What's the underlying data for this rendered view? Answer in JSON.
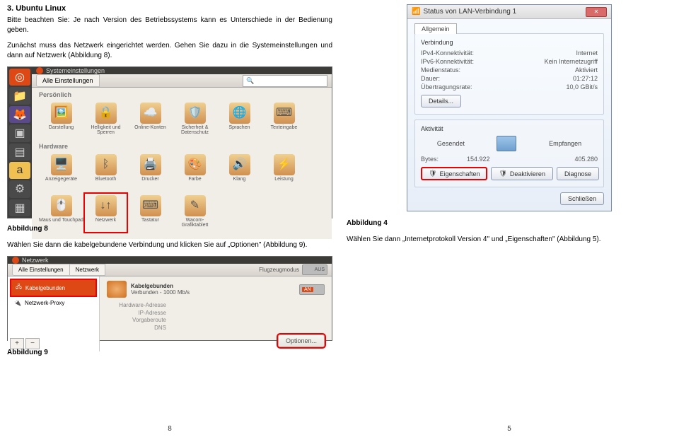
{
  "left": {
    "heading": "3. Ubuntu Linux",
    "p1": "Bitte beachten Sie: Je nach Version des Betriebssystems kann es Unterschiede in der Bedienung geben.",
    "p2": "Zunächst muss das Netzwerk eingerichtet werden. Gehen Sie dazu in die Systemeinstellungen und dann auf Netzwerk (Abbildung 8).",
    "ubuntu": {
      "window_title": "Systemeinstellungen",
      "crumb": "Alle Einstellungen",
      "search_placeholder": "",
      "search_icon": "🔍",
      "sect_personal": "Persönlich",
      "personal": [
        {
          "icon": "🖼️",
          "label": "Darstellung"
        },
        {
          "icon": "🔒",
          "label": "Helligkeit und Sperren"
        },
        {
          "icon": "☁️",
          "label": "Online-Konten"
        },
        {
          "icon": "🛡️",
          "label": "Sicherheit & Datenschutz"
        },
        {
          "icon": "🌐",
          "label": "Sprachen"
        },
        {
          "icon": "⌨",
          "label": "Texteingabe"
        }
      ],
      "sect_hardware": "Hardware",
      "hardware": [
        {
          "icon": "🖥️",
          "label": "Anzeigegeräte"
        },
        {
          "icon": "ᛒ",
          "label": "Bluetooth"
        },
        {
          "icon": "🖨️",
          "label": "Drucker"
        },
        {
          "icon": "🎨",
          "label": "Farbe"
        },
        {
          "icon": "🔊",
          "label": "Klang"
        },
        {
          "icon": "⚡",
          "label": "Leistung"
        },
        {
          "icon": "🖱️",
          "label": "Maus und Touchpad"
        },
        {
          "icon": "↓↑",
          "label": "Netzwerk",
          "hl": true
        },
        {
          "icon": "⌨",
          "label": "Tastatur"
        },
        {
          "icon": "✎",
          "label": "Wacom-Grafiktablett"
        }
      ]
    },
    "ab8": "Abbildung 8",
    "p3": "Wählen Sie dann die kabelgebundene Verbindung und klicken Sie auf „Optionen\" (Abbildung 9).",
    "unet": {
      "title": "Netzwerk",
      "crumb1": "Alle Einstellungen",
      "crumb2": "Netzwerk",
      "flugz": "Flugzeugmodus",
      "flugz_state": "AUS",
      "side": [
        {
          "icon": "🖧",
          "label": "Kabelgebunden",
          "sel": true
        },
        {
          "icon": "🔌",
          "label": "Netzwerk-Proxy"
        }
      ],
      "plus": "+",
      "minus": "−",
      "head": "Kabelgebunden",
      "sub": "Verbunden - 1000 Mb/s",
      "on_label": "AN",
      "rows": [
        {
          "k": "Hardware-Adresse",
          "v": ""
        },
        {
          "k": "IP-Adresse",
          "v": ""
        },
        {
          "k": "Vorgaberoute",
          "v": ""
        },
        {
          "k": "DNS",
          "v": ""
        }
      ],
      "opt": "Optionen..."
    },
    "ab9": "Abbildung 9",
    "page_no": "8"
  },
  "right": {
    "win": {
      "title_icon": "📶",
      "title": "Status von LAN-Verbindung 1",
      "tab": "Allgemein",
      "g1": "Verbindung",
      "rows1": [
        {
          "k": "IPv4-Konnektivität:",
          "v": "Internet"
        },
        {
          "k": "IPv6-Konnektivität:",
          "v": "Kein Internetzugriff"
        },
        {
          "k": "Medienstatus:",
          "v": "Aktiviert"
        },
        {
          "k": "Dauer:",
          "v": "01:27:12"
        },
        {
          "k": "Übertragungsrate:",
          "v": "10,0 GBit/s"
        }
      ],
      "details_btn": "Details...",
      "g2": "Aktivität",
      "sent": "Gesendet",
      "recv": "Empfangen",
      "bytes_k": "Bytes:",
      "bytes_sent": "154.922",
      "bytes_recv": "405.280",
      "btn_props": "Eigenschaften",
      "btn_props_icon": "🛡",
      "btn_deact": "Deaktivieren",
      "btn_deact_icon": "🛡",
      "btn_diag": "Diagnose",
      "close": "Schließen"
    },
    "ab4": "Abbildung 4",
    "p4": "Wählen Sie dann „Internetprotokoll Version 4\" und „Eigenschaften\" (Abbildung 5).",
    "page_no": "5"
  }
}
